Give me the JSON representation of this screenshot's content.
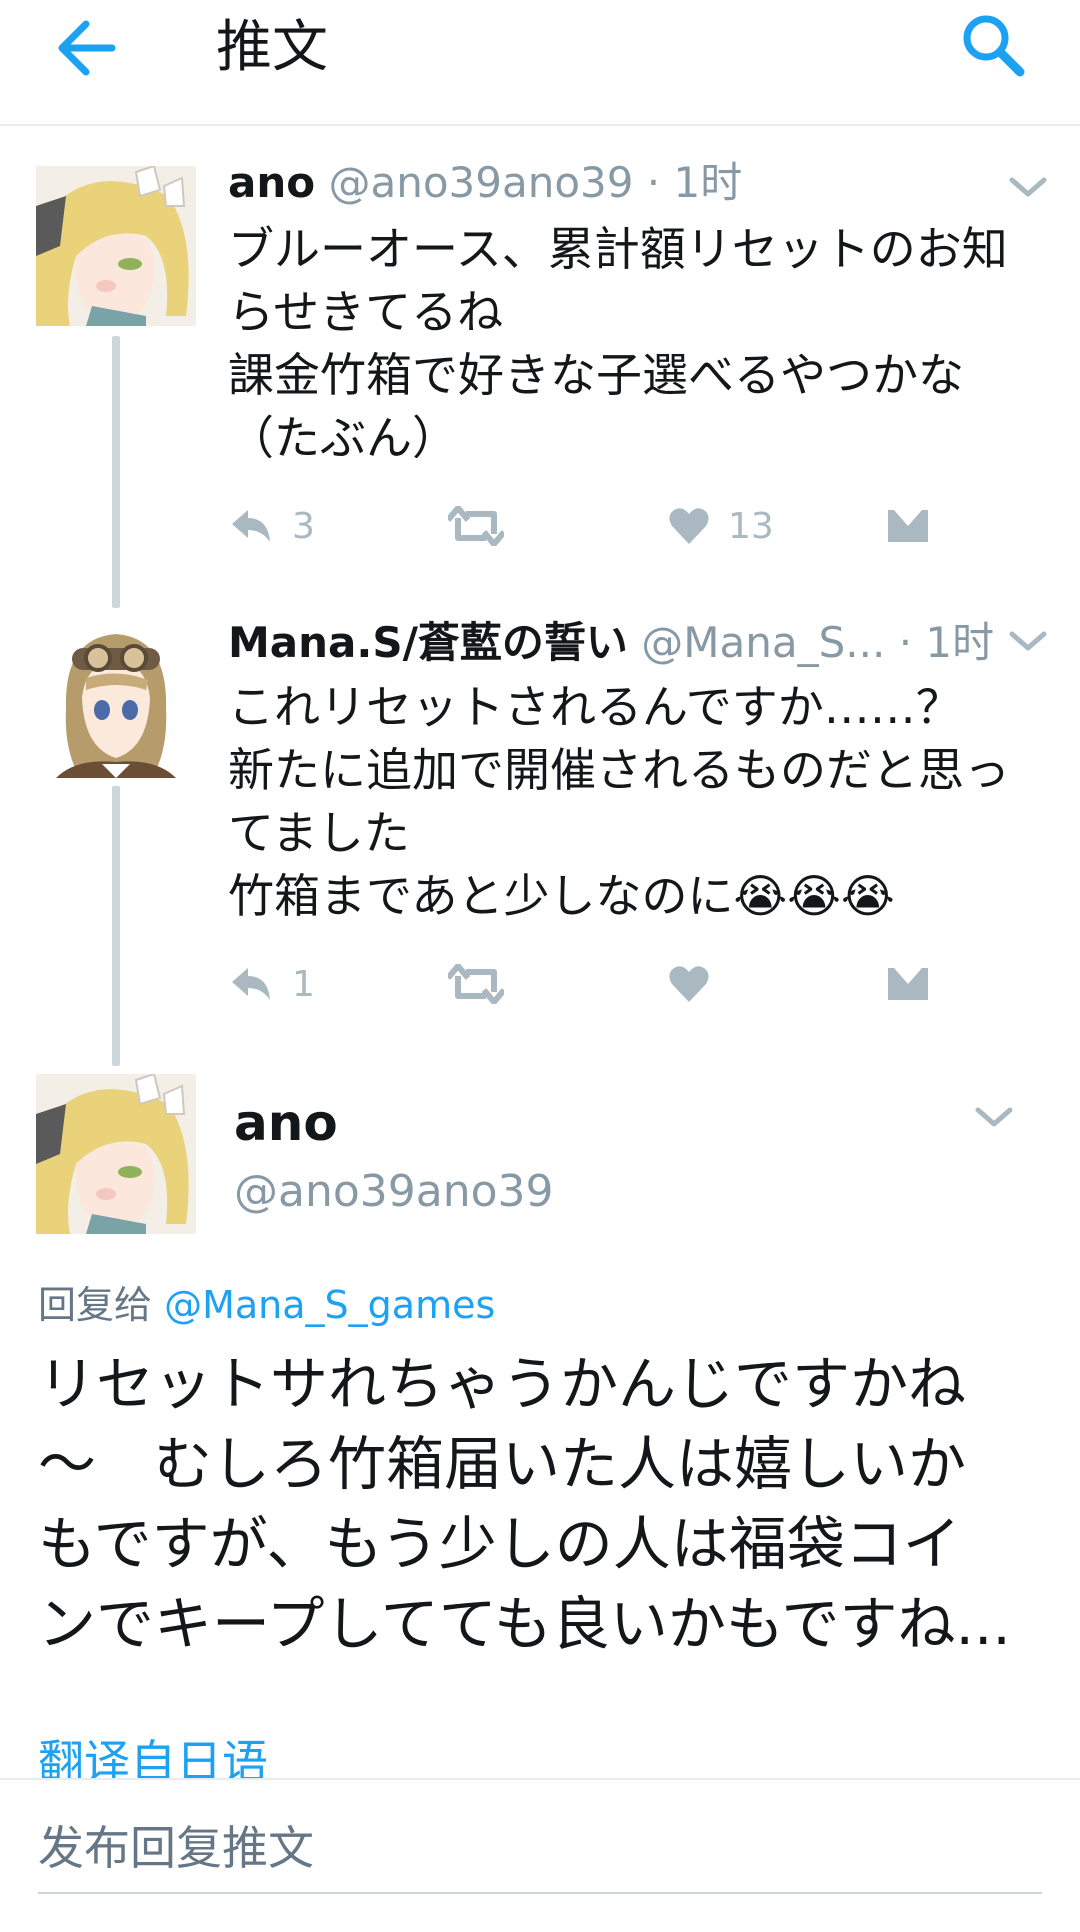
{
  "header": {
    "title": "推文",
    "back_icon": "arrow-left-icon",
    "search_icon": "search-icon",
    "accent_color": "#1da1f2"
  },
  "tweets": [
    {
      "name": "ano",
      "handle_time": "@ano39ano39 · 1时",
      "text": "ブルーオース、累計額リセットのお知\nらせきてるね\n課金竹箱で好きな子選べるやつかな\n（たぶん）",
      "reply_count": "3",
      "retweet_count": "",
      "like_count": "13"
    },
    {
      "name": "Mana.S/蒼藍の誓い",
      "handle_time": "@Mana_S... · 1时",
      "text": "これリセットされるんですか……？\n新たに追加で開催されるものだと思っ\nてました\n竹箱まであと少しなのに😭😭😭",
      "reply_count": "1",
      "retweet_count": "",
      "like_count": ""
    }
  ],
  "focused": {
    "name": "ano",
    "handle": "@ano39ano39",
    "reply_to_label": "回复给",
    "reply_to_handle": "@Mana_S_games",
    "text": "リセットサれちゃうかんじですかね\n〜　むしろ竹箱届いた人は嬉しいか\nもですが、もう少しの人は福袋コイ\nンでキープしてても良いかもですね...",
    "translate_label": "翻译自日语"
  },
  "reply_bar": {
    "placeholder": "发布回复推文"
  }
}
